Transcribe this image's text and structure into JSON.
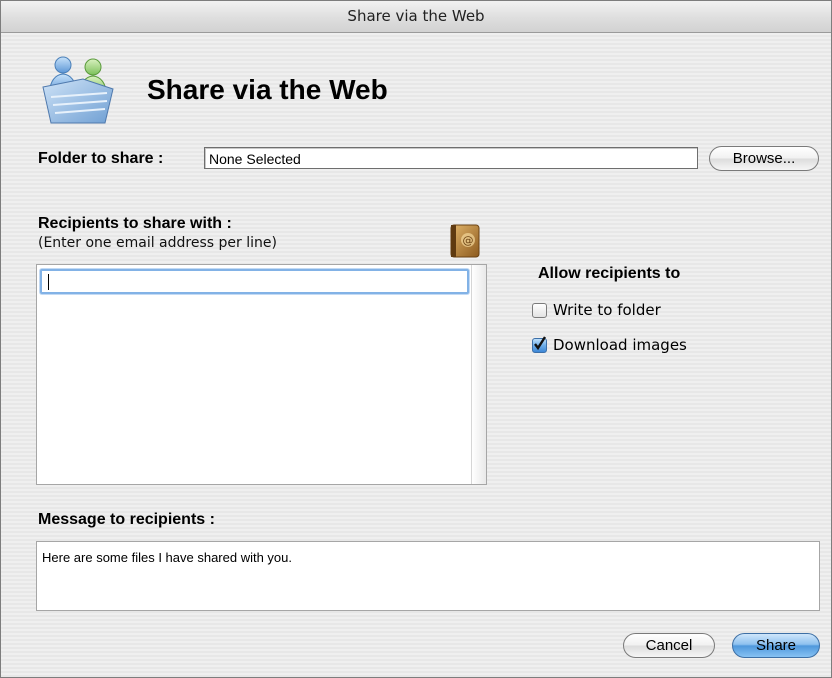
{
  "window": {
    "title": "Share via the Web"
  },
  "header": {
    "title": "Share via the Web",
    "icon": "shared-folder-icon"
  },
  "folder": {
    "label": "Folder to share :",
    "value": "None Selected",
    "browse_label": "Browse..."
  },
  "recipients": {
    "label": "Recipients to share with :",
    "hint": "(Enter one email address per line)",
    "value": "",
    "address_book_icon": "address-book-icon"
  },
  "permissions": {
    "title": "Allow recipients to",
    "options": [
      {
        "label": "Write to folder",
        "checked": false
      },
      {
        "label": "Download images",
        "checked": true
      }
    ]
  },
  "message": {
    "label": "Message to recipients :",
    "value": "Here are some files I have shared with you."
  },
  "buttons": {
    "cancel_label": "Cancel",
    "share_label": "Share"
  },
  "colors": {
    "accent": "#4f98dc",
    "focus_ring": "#82b2e6"
  }
}
